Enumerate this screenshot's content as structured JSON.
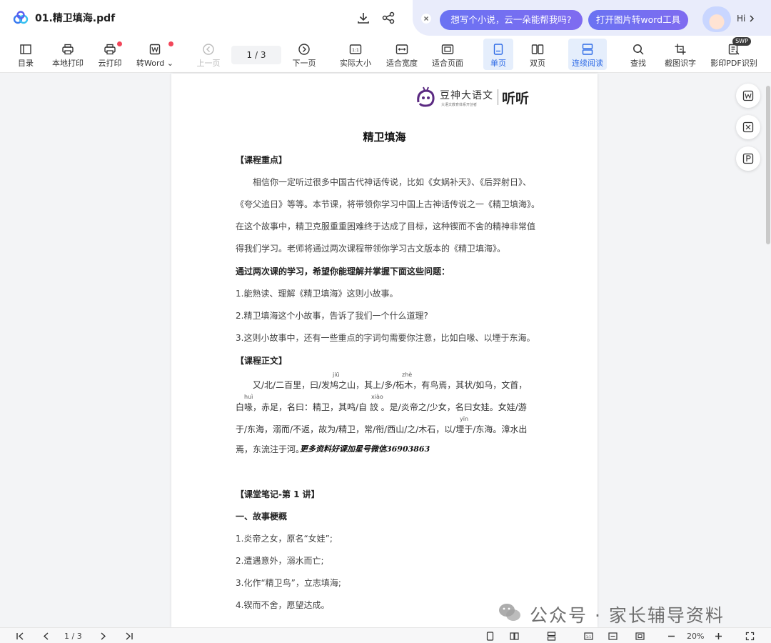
{
  "titlebar": {
    "file_name": "01.精卫填海.pdf",
    "ai_prompt_1": "想写个小说，云一朵能帮我吗?",
    "ai_prompt_2": "打开图片转word工具",
    "greeting": "Hi"
  },
  "toolbar": {
    "items": [
      {
        "label": "目录",
        "icon": "toc-icon"
      },
      {
        "label": "本地打印",
        "icon": "printer-icon"
      },
      {
        "label": "云打印",
        "icon": "cloud-printer-icon"
      },
      {
        "label": "转Word",
        "icon": "word-icon"
      },
      {
        "label": "上一页",
        "icon": "prev-page-icon"
      },
      {
        "label": "下一页",
        "icon": "next-page-icon"
      },
      {
        "label": "实际大小",
        "icon": "actual-size-icon"
      },
      {
        "label": "适合宽度",
        "icon": "fit-width-icon"
      },
      {
        "label": "适合页面",
        "icon": "fit-page-icon"
      },
      {
        "label": "单页",
        "icon": "single-page-icon"
      },
      {
        "label": "双页",
        "icon": "double-page-icon"
      },
      {
        "label": "连续阅读",
        "icon": "continuous-icon"
      },
      {
        "label": "查找",
        "icon": "search-icon"
      },
      {
        "label": "截图识字",
        "icon": "screenshot-ocr-icon"
      },
      {
        "label": "影印PDF识别",
        "icon": "scan-pdf-icon"
      }
    ],
    "page_indicator": "1 / 3",
    "swp_badge": "SWP"
  },
  "document": {
    "brand_name": "豆神大语文",
    "brand_tagline": "大语文教育体系开创者",
    "brand_secondary": "听听",
    "title": "精卫填海",
    "lines": [
      "【课程重点】",
      "相信你一定听过很多中国古代神话传说，比如《女娲补天》、《后羿射日》、",
      "《夸父追日》等等。本节课，将带领你学习中国上古神话传说之一《精卫填海》。",
      "在这个故事中，精卫克服重重困难终于达成了目标，这种锲而不舍的精神非常值",
      "得我们学习。老师将通过两次课程带领你学习古文版本的《精卫填海》。",
      "通过两次课的学习，希望你能理解并掌握下面这些问题：",
      "1.能熟读、理解《精卫填海》这则小故事。",
      "2.精卫填海这个小故事，告诉了我们一个什么道理?",
      "3.这则小故事中，还有一些重点的字词句需要你注意，比如白喙、以堙于东海。",
      "【课程正文】",
      "又/北/二百里，曰/发鸠之山，其上/多/柘木，有鸟焉，其状/如乌，文首，",
      "白喙，赤足，名曰：精卫，其鸣/自 詨 。是/炎帝之/少女，名曰女娃。女娃/游",
      "于/东海，溺而/不返，故为/精卫，常/衔/西山/之/木石，以/堙于/东海。漳水出",
      "焉，东流注于河。",
      "【课堂笔记-第 1 讲】",
      "一、故事梗概",
      "1.炎帝之女，原名“女娃”;",
      "2.遭遇意外，溺水而亡;",
      "3.化作“精卫鸟”，立志填海;",
      "4.锲而不舍，愿望达成。"
    ],
    "pinyin": [
      "jiū",
      "zhè",
      "huì",
      "xiào",
      "yīn"
    ],
    "inline_watermark": "更多资料好课加星号微信36903863"
  },
  "watermark": {
    "text": "公众号 · 家长辅导资料"
  },
  "statusbar": {
    "page_indicator": "1 / 3",
    "zoom": "20%"
  },
  "colors": {
    "accent": "#2e6be6",
    "pill": "#6a73f2",
    "badge": "#f2465a"
  }
}
